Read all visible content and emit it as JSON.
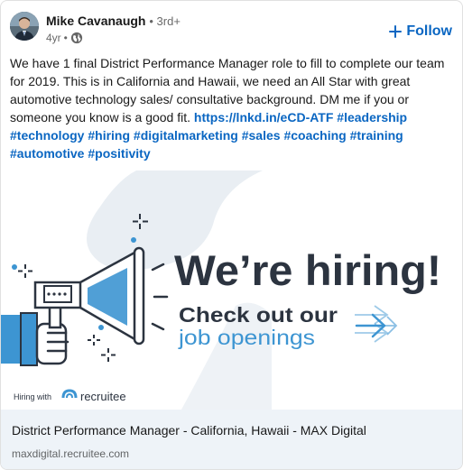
{
  "post": {
    "author_name": "Mike Cavanaugh",
    "degree": "3rd+",
    "time_ago": "4yr",
    "follow_label": "Follow",
    "text_intro": "We have 1 final District Performance Manager role to fill to complete our team for 2019. This is in California and Hawaii, we need an All Star with great automotive technology sales/ consultative background. DM me if you or someone you know is a good fit.",
    "link_text": "https://lnkd.in/eCD-ATF",
    "hashtags": [
      "#leadership",
      "#technology",
      "#hiring",
      "#digitalmarketing",
      "#sales",
      "#coaching",
      "#training",
      "#automotive",
      "#positivity"
    ]
  },
  "banner": {
    "headline": "We’re hiring!",
    "cta_line1": "Check out our",
    "cta_line2": "job openings",
    "hiring_with": "Hiring with",
    "brand": "recruitee"
  },
  "link_preview": {
    "title": "District Performance Manager - California, Hawaii - MAX Digital",
    "domain": "maxdigital.recruitee.com"
  },
  "colors": {
    "accent": "#0a66c2",
    "banner_blue": "#3d95d2",
    "banner_dark": "#2c3440",
    "link_bg": "#eef3f8"
  }
}
